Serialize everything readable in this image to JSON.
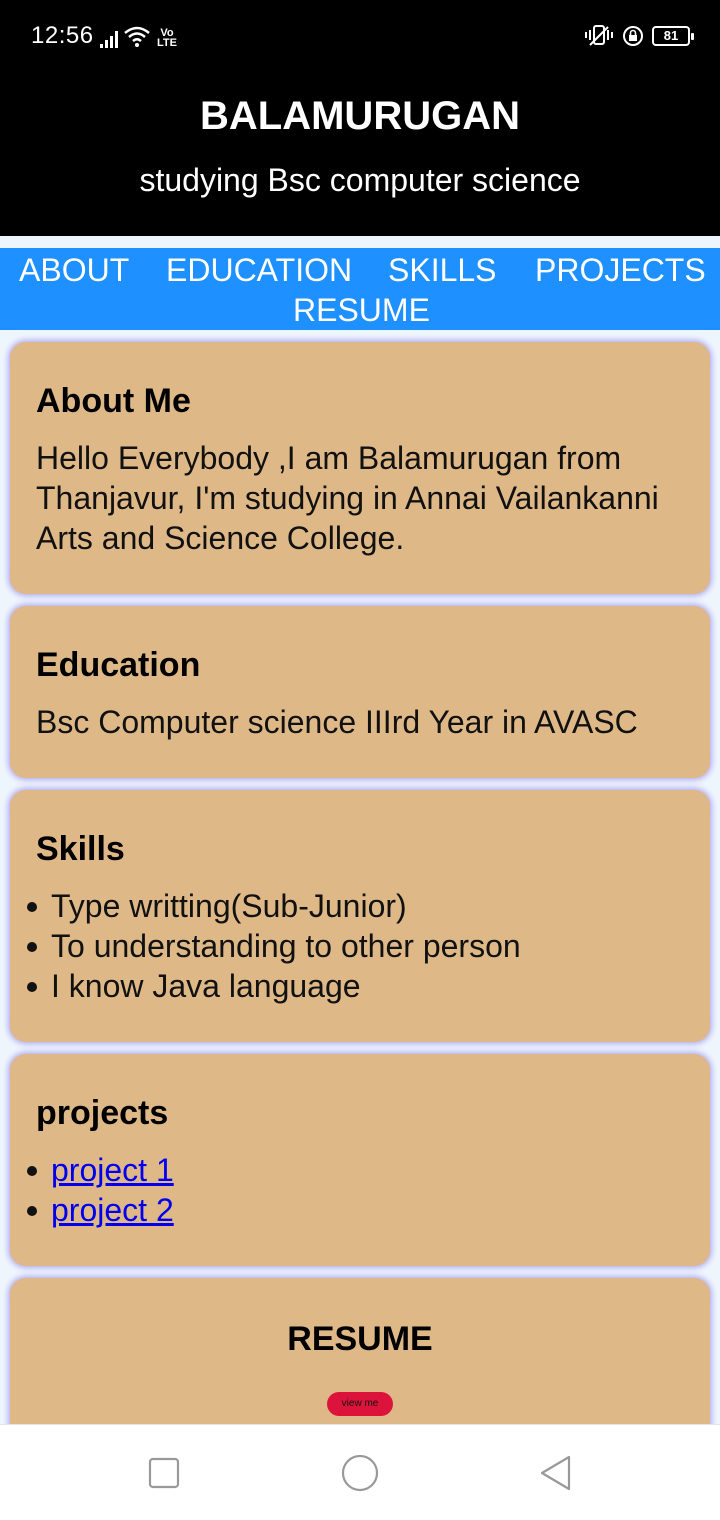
{
  "status_bar": {
    "time": "12:56",
    "network_label": "Vo LTE",
    "battery_level": "81"
  },
  "header": {
    "name": "BALAMURUGAN",
    "subtitle": "studying Bsc computer science"
  },
  "nav": {
    "items": [
      "ABOUT",
      "EDUCATION",
      "SKILLS",
      "PROJECTS",
      "RESUME"
    ]
  },
  "about": {
    "title": "About Me",
    "text": "Hello Everybody ,I am Balamurugan from Thanjavur, I'm studying in Annai Vailankanni Arts and Science College."
  },
  "education": {
    "title": "Education",
    "text": "Bsc Computer science IIIrd Year in AVASC"
  },
  "skills": {
    "title": "Skills",
    "items": [
      "Type writting(Sub-Junior)",
      "To understanding to other person",
      "I know Java language"
    ]
  },
  "projects": {
    "title": "projects",
    "links": [
      "project 1",
      "project 2"
    ]
  },
  "resume": {
    "title": "RESUME",
    "button_label": "view me"
  },
  "colors": {
    "header_bg": "#000000",
    "nav_bg": "#1e90ff",
    "card_bg": "#deb887",
    "button_bg": "#dc143c",
    "link": "#0000ee"
  },
  "icons": {
    "status_left": [
      "signal-icon",
      "wifi-icon"
    ],
    "status_right": [
      "vibrate-icon",
      "lock-rotation-icon",
      "battery-icon"
    ],
    "android_nav": [
      "recents-icon",
      "home-icon",
      "back-icon"
    ]
  }
}
